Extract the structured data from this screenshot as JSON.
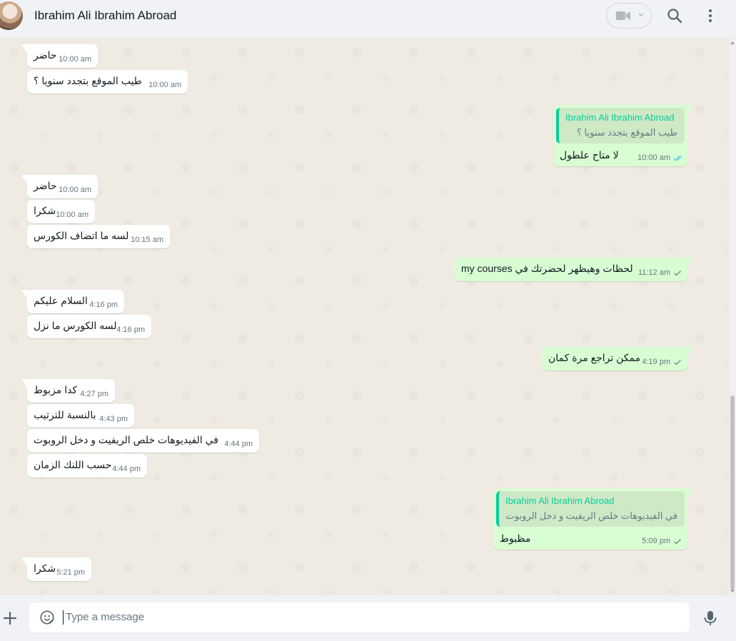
{
  "header": {
    "contact_name": "Ibrahim Ali Ibrahim Abroad",
    "icons": [
      "video-call-icon",
      "chevron-down-icon",
      "search-icon",
      "menu-icon"
    ]
  },
  "messages": [
    {
      "dir": "in",
      "text": "حاضر",
      "time": "10:00 am"
    },
    {
      "dir": "in",
      "text": "طيب الموقع بتجدد سنويا ؟",
      "time": "10:00 am"
    },
    {
      "dir": "out",
      "quote_author": "Ibrahim Ali Ibrahim Abroad",
      "quote_text": "طيب الموقع بتجدد سنويا ؟",
      "text": "لا متاح علطول",
      "time": "10:00 am",
      "status": "read"
    },
    {
      "dir": "in",
      "text": "حاضر",
      "time": "10:00 am"
    },
    {
      "dir": "in",
      "text": "شكرا",
      "time": "10:00 am"
    },
    {
      "dir": "in",
      "text": "لسه ما اتضاف الكورس",
      "time": "10:15 am"
    },
    {
      "dir": "out",
      "text": "لحظات وهيظهر لحضرتك في my courses",
      "time": "11:12 am",
      "status": "sent"
    },
    {
      "dir": "in",
      "text": "السلام عليكم",
      "time": "4:16 pm"
    },
    {
      "dir": "in",
      "text": "لسه الكورس ما نزل",
      "time": "4:16 pm"
    },
    {
      "dir": "out",
      "text": "ممكن تراجع مرة كمان",
      "time": "4:19 pm",
      "status": "sent"
    },
    {
      "dir": "in",
      "text": "كدا مزبوط",
      "time": "4:27 pm"
    },
    {
      "dir": "in",
      "text": "بالنسبة للترتيب",
      "time": "4:43 pm"
    },
    {
      "dir": "in",
      "text": "في الفيديوهات خلص الريفيت و دخل الروبوت",
      "time": "4:44 pm"
    },
    {
      "dir": "in",
      "text": "حسب اللنك الزمان",
      "time": "4:44 pm"
    },
    {
      "dir": "out",
      "quote_author": "Ibrahim Ali Ibrahim Abroad",
      "quote_text": "في الفيديوهات خلص الريفيت و دخل الروبوت",
      "text": "مظبوط",
      "time": "5:09 pm",
      "status": "sent"
    },
    {
      "dir": "in",
      "text": "شكرا",
      "time": "5:21 pm"
    }
  ],
  "composer": {
    "placeholder": "Type a message"
  },
  "colors": {
    "chat_bg": "#efeae2",
    "incoming_bubble": "#ffffff",
    "outgoing_bubble": "#d9fdd3",
    "quote_accent": "#06cf9c",
    "read_tick": "#53bdeb",
    "sent_tick": "#667781"
  }
}
